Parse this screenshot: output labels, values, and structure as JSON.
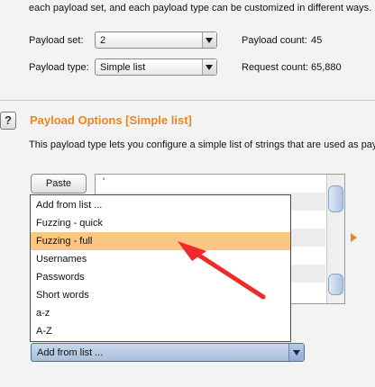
{
  "intro_text": "each payload set, and each payload type can be customized in different ways.",
  "payload_set": {
    "label": "Payload set:",
    "value": "2"
  },
  "payload_type": {
    "label": "Payload type:",
    "value": "Simple list"
  },
  "payload_count": {
    "label": "Payload count:",
    "value": "45"
  },
  "request_count": {
    "label": "Request count:",
    "value": "65,880"
  },
  "help_icon": {
    "glyph": "?"
  },
  "section": {
    "title": "Payload Options [Simple list]",
    "description": "This payload type lets you configure a simple list of strings that are used as pay"
  },
  "paste_button": {
    "label": "Paste"
  },
  "list": {
    "first_value": "'"
  },
  "dropdown": {
    "items": [
      {
        "label": "Add from list ..."
      },
      {
        "label": "Fuzzing - quick"
      },
      {
        "label": "Fuzzing - full",
        "selected": true
      },
      {
        "label": "Usernames"
      },
      {
        "label": "Passwords"
      },
      {
        "label": "Short words"
      },
      {
        "label": "a-z"
      },
      {
        "label": "A-Z"
      }
    ]
  },
  "add_from_list_combo": {
    "value": "Add from list ..."
  },
  "annotation": {
    "arrow_color": "#ee2a2a",
    "highlight_color": "#fbc582",
    "accent_color": "#e8891f"
  }
}
